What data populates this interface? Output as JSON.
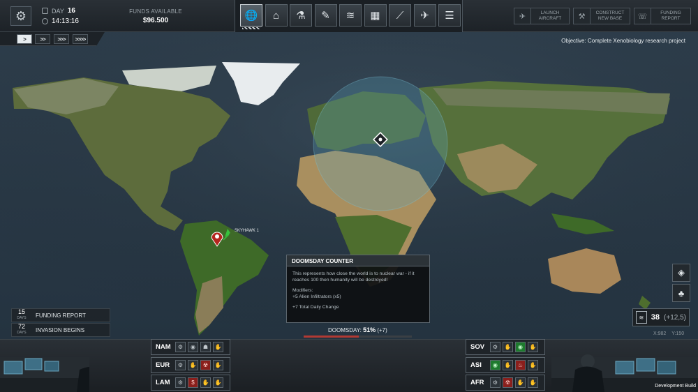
{
  "top": {
    "day_label": "DAY",
    "day_value": "16",
    "time": "14:13:16",
    "funds_label": "FUNDS AVAILABLE",
    "funds_value": "$96.500",
    "nav_tabs": [
      {
        "name": "geoscape-tab",
        "icon": "globe-icon",
        "glyph": "🌐"
      },
      {
        "name": "base-tab",
        "icon": "hangar-icon",
        "glyph": "⌂"
      },
      {
        "name": "research-tab",
        "icon": "microscope-icon",
        "glyph": "⚗"
      },
      {
        "name": "engineering-tab",
        "icon": "wrench-icon",
        "glyph": "✎"
      },
      {
        "name": "soldiers-tab",
        "icon": "rank-chevrons-icon",
        "glyph": "≋"
      },
      {
        "name": "stores-tab",
        "icon": "crates-icon",
        "glyph": "▦"
      },
      {
        "name": "weapons-tab",
        "icon": "rifle-icon",
        "glyph": "⟋"
      },
      {
        "name": "aircraft-tab",
        "icon": "jet-icon",
        "glyph": "✈"
      },
      {
        "name": "archive-tab",
        "icon": "cabinet-icon",
        "glyph": "☰"
      }
    ],
    "actions": [
      {
        "name": "launch-aircraft-button",
        "icon": "plane-icon",
        "glyph": "✈",
        "label": "LAUNCH AIRCRAFT"
      },
      {
        "name": "construct-base-button",
        "icon": "excavator-icon",
        "glyph": "⚒",
        "label": "CONSTRUCT NEW BASE"
      },
      {
        "name": "funding-report-button",
        "icon": "phone-icon",
        "glyph": "☏",
        "label": "FUNDING REPORT"
      }
    ]
  },
  "speed_buttons": [
    ">",
    ">>",
    ">>>",
    ">>>>"
  ],
  "objective": "Objective: Complete Xenobiology research project",
  "map": {
    "aircraft_label": "SKYHAWK 1"
  },
  "calendar": [
    {
      "days": "15",
      "unit": "DAYS",
      "label": "FUNDING REPORT"
    },
    {
      "days": "72",
      "unit": "DAYS",
      "label": "INVASION BEGINS"
    }
  ],
  "doomsday": {
    "title": "DOOMSDAY COUNTER",
    "desc": "This represents how close the world is to nuclear war - if it reaches 100 then humanity will be destroyed!",
    "modifiers_label": "Modifiers:",
    "modifier": "+5 Alien Infiltrators (x5)",
    "total": "+7 Total Daily Change",
    "label": "DOOMSDAY:",
    "value": "51%",
    "change": "(+7)",
    "level": 0.51
  },
  "score": {
    "value": "38",
    "change": "(+12,5)"
  },
  "coords": {
    "x": "X:982",
    "y": "Y:150"
  },
  "regions_left": [
    {
      "code": "NAM",
      "slots": [
        {
          "g": "⚙",
          "c": ""
        },
        {
          "g": "◉",
          "c": ""
        },
        {
          "g": "☗",
          "c": ""
        },
        {
          "g": "✋",
          "c": ""
        }
      ]
    },
    {
      "code": "EUR",
      "slots": [
        {
          "g": "⚙",
          "c": ""
        },
        {
          "g": "✋",
          "c": ""
        },
        {
          "g": "☢",
          "c": "red"
        },
        {
          "g": "✋",
          "c": ""
        }
      ]
    },
    {
      "code": "LAM",
      "slots": [
        {
          "g": "⚙",
          "c": ""
        },
        {
          "g": "$",
          "c": "red"
        },
        {
          "g": "✋",
          "c": ""
        },
        {
          "g": "✋",
          "c": ""
        }
      ]
    }
  ],
  "regions_right": [
    {
      "code": "SOV",
      "slots": [
        {
          "g": "⚙",
          "c": ""
        },
        {
          "g": "✋",
          "c": ""
        },
        {
          "g": "◉",
          "c": "green"
        },
        {
          "g": "✋",
          "c": ""
        }
      ]
    },
    {
      "code": "ASI",
      "slots": [
        {
          "g": "◉",
          "c": "green"
        },
        {
          "g": "✋",
          "c": ""
        },
        {
          "g": "♨",
          "c": "red"
        },
        {
          "g": "✋",
          "c": ""
        }
      ]
    },
    {
      "code": "AFR",
      "slots": [
        {
          "g": "⚙",
          "c": ""
        },
        {
          "g": "☢",
          "c": "red"
        },
        {
          "g": "✋",
          "c": ""
        },
        {
          "g": "✋",
          "c": ""
        }
      ]
    }
  ],
  "dev_build": "Development Build"
}
